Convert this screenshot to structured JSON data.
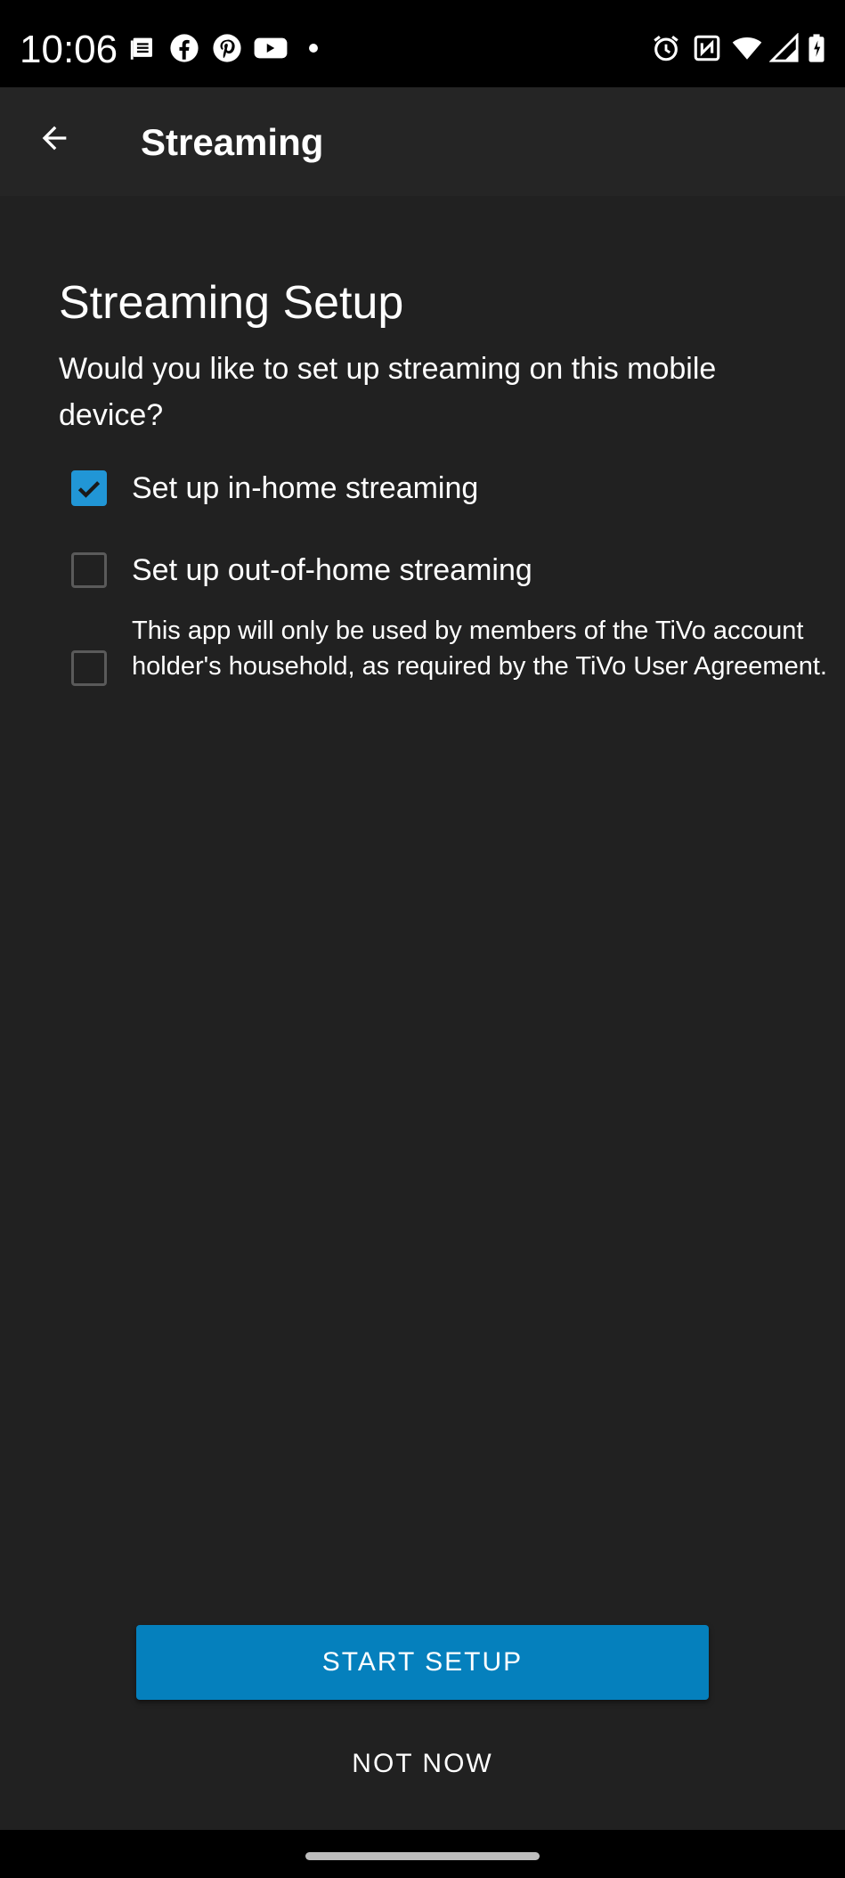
{
  "status_bar": {
    "time": "10:06",
    "notification_icons": [
      "news-icon",
      "facebook-icon",
      "pinterest-icon",
      "youtube-icon",
      "dot-icon"
    ],
    "system_icons": [
      "alarm-icon",
      "nfc-icon",
      "wifi-icon",
      "signal-icon",
      "battery-icon"
    ]
  },
  "app_bar": {
    "title": "Streaming",
    "back_icon": "arrow-back-icon"
  },
  "setup": {
    "heading": "Streaming Setup",
    "question": "Would you like to set up streaming on this mobile device?",
    "options": [
      {
        "label": "Set up in-home streaming",
        "checked": true
      },
      {
        "label": "Set up out-of-home streaming",
        "checked": false
      },
      {
        "label": "This app will only be used by members of the TiVo account holder's household, as required by the TiVo User Agreement.",
        "checked": false
      }
    ]
  },
  "actions": {
    "start_label": "START SETUP",
    "not_now_label": "NOT NOW"
  },
  "colors": {
    "background": "#212121",
    "app_bar": "#252525",
    "accent": "#0580bd",
    "checkbox_checked": "#2196d6"
  }
}
